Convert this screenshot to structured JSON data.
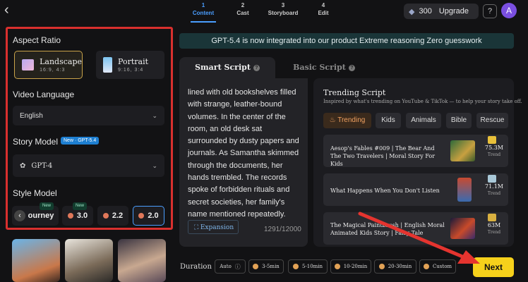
{
  "steps": [
    {
      "num": "1",
      "label": "Content"
    },
    {
      "num": "2",
      "label": "Cast"
    },
    {
      "num": "3",
      "label": "Storyboard"
    },
    {
      "num": "4",
      "label": "Edit"
    }
  ],
  "header": {
    "credits": "300",
    "upgrade": "Upgrade",
    "help": "?",
    "avatar": "A"
  },
  "settings": {
    "aspect_ratio_title": "Aspect Ratio",
    "aspect_options": [
      {
        "label": "Landscape",
        "sub": "16:9,  4:3"
      },
      {
        "label": "Portrait",
        "sub": "9:16,  3:4"
      }
    ],
    "video_language_title": "Video Language",
    "video_language": "English",
    "story_model_title": "Story Model",
    "story_model_badge": "New · GPT-5.4",
    "story_model": "GPT-4",
    "style_model_title": "Style Model",
    "style_models": [
      "ourney",
      "3.0",
      "2.2",
      "2.0"
    ],
    "new_tag": "New"
  },
  "banner": "GPT-5.4 is now integrated into our product Extreme reasoning Zero guesswork",
  "tabs": {
    "smart": "Smart Script",
    "basic": "Basic Script"
  },
  "story_text": "lined with old bookshelves filled with strange, leather-bound volumes. In the center of the room, an old desk sat surrounded by dusty papers and journals. As Samantha skimmed through the documents, her hands trembled. The records spoke of forbidden rituals and secret societies, her family's name mentioned repeatedly.",
  "expansion": "Expansion",
  "counter": "1291/12000",
  "trending": {
    "title": "Trending Script",
    "subtitle": "Inspired by what's trending on YouTube & TikTok — to help your story take off.",
    "chips": [
      "Trending",
      "Kids",
      "Animals",
      "Bible",
      "Rescue"
    ],
    "cards": [
      {
        "title": "Aesop's Fables #009 | The Bear And The Two Travelers | Moral Story For Kids",
        "views": "75.3M",
        "trend": "Trend"
      },
      {
        "title": "What Happens When You Don't Listen",
        "views": "71.1M",
        "trend": "Trend"
      },
      {
        "title": "The Magical Paintbrush | English Moral Animated Kids Story | Fairy Tale",
        "views": "63M",
        "trend": "Trend"
      }
    ]
  },
  "duration": {
    "label": "Duration",
    "options": [
      "Auto",
      "3-5min",
      "5-10min",
      "10-20min",
      "20-30min",
      "Custom"
    ]
  },
  "next": "Next",
  "colors": {
    "accent": "#4a9eff",
    "highlight_box": "#d9302e",
    "next_button": "#f6d11b",
    "arrow": "#e5342f"
  }
}
